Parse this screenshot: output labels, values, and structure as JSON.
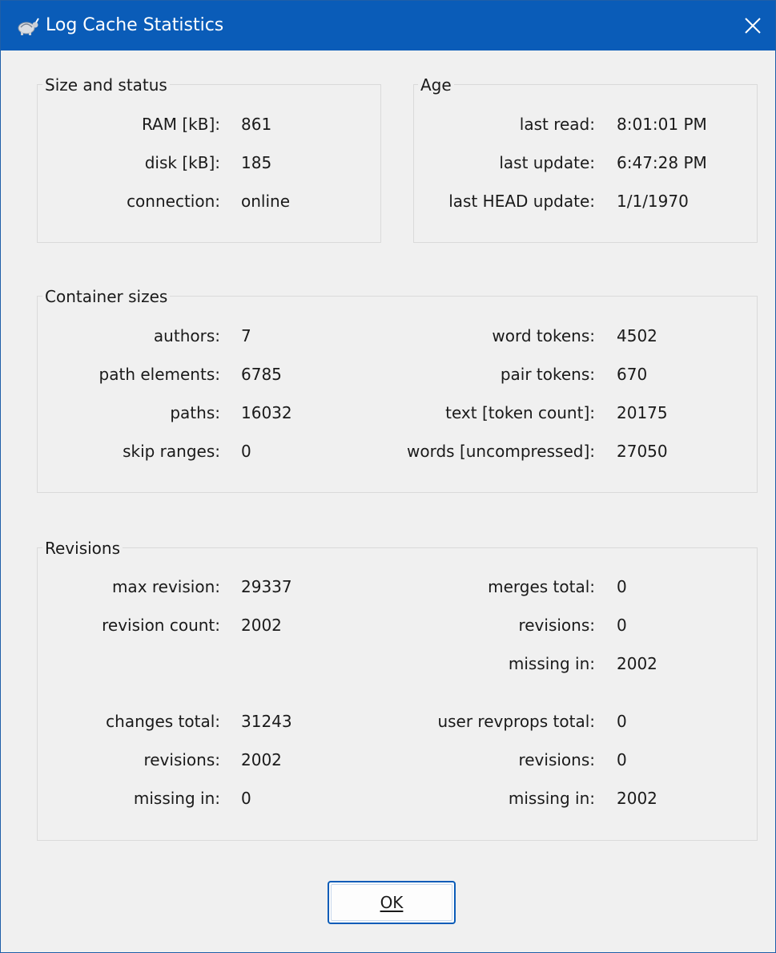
{
  "window": {
    "title": "Log Cache Statistics",
    "icon": "tortoise-icon",
    "close_icon": "close-icon",
    "titlebar_color": "#0a5cb8"
  },
  "size_status": {
    "title": "Size and status",
    "rows": [
      {
        "label": "RAM [kB]:",
        "value": "861"
      },
      {
        "label": "disk [kB]:",
        "value": "185"
      },
      {
        "label": "connection:",
        "value": "online"
      }
    ]
  },
  "age": {
    "title": "Age",
    "rows": [
      {
        "label": "last read:",
        "value": "8:01:01 PM"
      },
      {
        "label": "last update:",
        "value": "6:47:28 PM"
      },
      {
        "label": "last HEAD update:",
        "value": "1/1/1970"
      }
    ]
  },
  "container_sizes": {
    "title": "Container sizes",
    "left": [
      {
        "label": "authors:",
        "value": "7"
      },
      {
        "label": "path elements:",
        "value": "6785"
      },
      {
        "label": "paths:",
        "value": "16032"
      },
      {
        "label": "skip ranges:",
        "value": "0"
      }
    ],
    "right": [
      {
        "label": "word tokens:",
        "value": "4502"
      },
      {
        "label": "pair tokens:",
        "value": "670"
      },
      {
        "label": "text [token count]:",
        "value": "20175"
      },
      {
        "label": "words [uncompressed]:",
        "value": "27050"
      }
    ]
  },
  "revisions": {
    "title": "Revisions",
    "left_top": [
      {
        "label": "max revision:",
        "value": "29337"
      },
      {
        "label": "revision count:",
        "value": "2002"
      }
    ],
    "right_top": [
      {
        "label": "merges total:",
        "value": "0"
      },
      {
        "label": "revisions:",
        "value": "0"
      },
      {
        "label": "missing in:",
        "value": "2002"
      }
    ],
    "left_bottom": [
      {
        "label": "changes total:",
        "value": "31243"
      },
      {
        "label": "revisions:",
        "value": "2002"
      },
      {
        "label": "missing in:",
        "value": "0"
      }
    ],
    "right_bottom": [
      {
        "label": "user revprops total:",
        "value": "0"
      },
      {
        "label": "revisions:",
        "value": "0"
      },
      {
        "label": "missing in:",
        "value": "2002"
      }
    ]
  },
  "buttons": {
    "ok_label": "OK"
  }
}
